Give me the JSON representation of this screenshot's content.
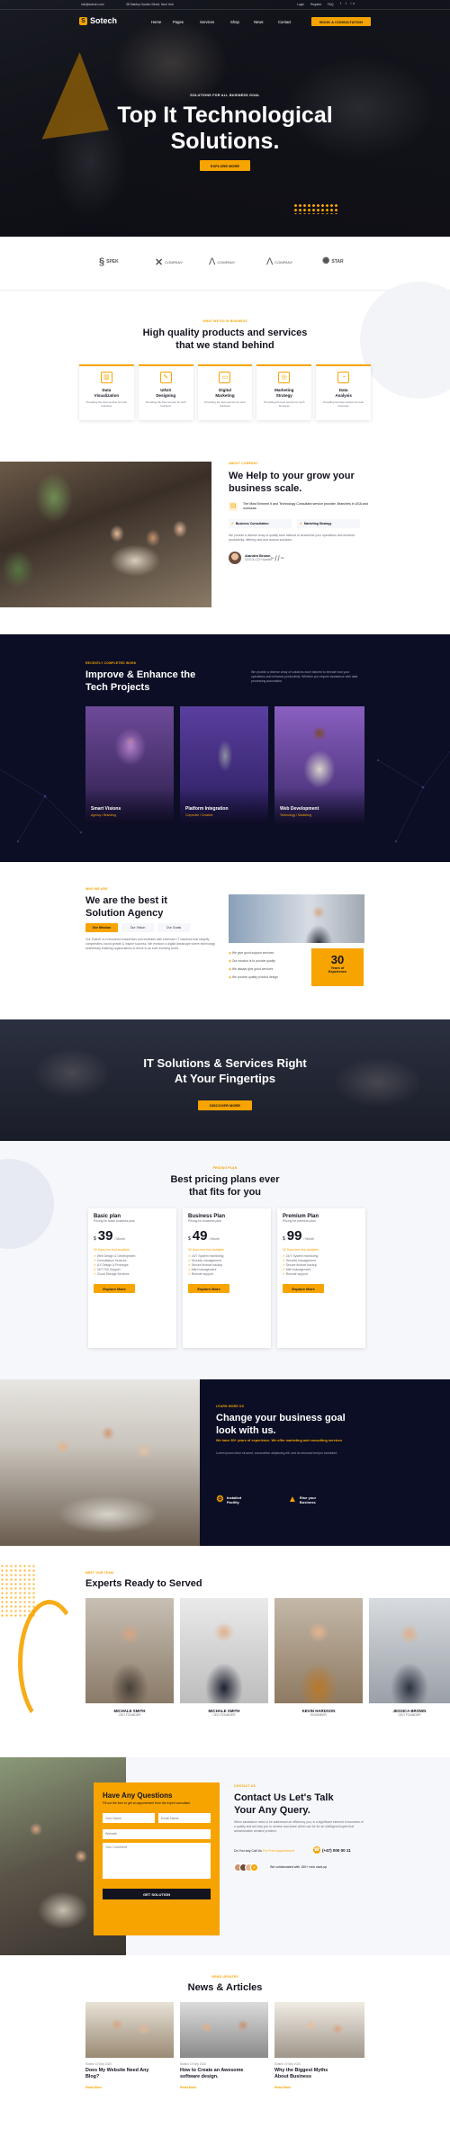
{
  "colors": {
    "accent": "#f7a400",
    "dark": "#13141f",
    "navy": "#0b0e24"
  },
  "topbar": {
    "email": "info@sotech.com",
    "address": "38 Stanley Garden Street, New York",
    "links": [
      "Login",
      "Register",
      "FAQ"
    ]
  },
  "header": {
    "logo_text": "Sotech",
    "nav": [
      "Home",
      "Pages",
      "Services",
      "Shop",
      "News",
      "Contact"
    ],
    "cta": "BOOK A CONSULTATION"
  },
  "hero": {
    "kicker": "SOLUTIONS FOR ALL BUSINESS GOAL",
    "title_line1": "Top It Technological",
    "title_line2": "Solutions.",
    "button": "EXPLORE MORE"
  },
  "brands": [
    "SPEK",
    "COMPANY",
    "COMPANY",
    "COMPANY",
    "STAR"
  ],
  "features": {
    "kicker": "WHAT WE DO IN BUSINESS",
    "title_line1": "High quality products and services",
    "title_line2": "that we stand behind",
    "items": [
      {
        "title_line1": "Data",
        "title_line2": "Visualization",
        "desc": "Providing the best service for tech business"
      },
      {
        "title_line1": "UI/UX",
        "title_line2": "Designing",
        "desc": "Providing the best service for tech business"
      },
      {
        "title_line1": "Digital",
        "title_line2": "Marketing",
        "desc": "Providing the best service for tech business"
      },
      {
        "title_line1": "Marketing",
        "title_line2": "Strategy",
        "desc": "Providing the best service for tech business"
      },
      {
        "title_line1": "Data",
        "title_line2": "Analysis",
        "desc": "Providing the best service for tech business"
      }
    ]
  },
  "about": {
    "kicker": "ABOUT COMPANY",
    "title_line1": "We Help to your grow your",
    "title_line2": "business scale.",
    "highlight": "The Most Eminent It and Technology Consultant service provider. Branches in USA and overseas.",
    "checks": [
      "Business Consultation",
      "Marketing Strategy"
    ],
    "para": "We provide a diverse array of quality work tailored to streamline your operations and enhance productivity, offering new and custom solutions.",
    "author_name": "Alandra Brown",
    "author_role": "CEO & CO Founder"
  },
  "projects": {
    "kicker": "RECENTLY COMPLETED WORK",
    "title_line1": "Improve & Enhance the",
    "title_line2": "Tech Projects",
    "desc": "We provide a diverse array of solutions each tailored to elevate how your operations and enhance productivity. Whether you require assistance with data processing automation.",
    "items": [
      {
        "title": "Smart Visions",
        "tags": "Agency / Branding"
      },
      {
        "title": "Platform Integration",
        "tags": "Corporate / Creative"
      },
      {
        "title": "Web Development",
        "tags": "Technology / Marketing"
      }
    ]
  },
  "agency": {
    "kicker": "WHO WE ARE",
    "title_line1": "We are the best it",
    "title_line2": "Solution Agency",
    "tabs": [
      "Our Mission",
      "Our Vision",
      "Our Goals"
    ],
    "para": "Our Sotech is a renowned businesses and institutes with extensive IT solutions that simplify complexities, boost growth & inspire success. We envision a digital landscape where technology seamlessly enabling organizations to thrive in an ever-evolving world.",
    "list": [
      "We give good support services",
      "Our mission is to provide quality",
      "We always give good services",
      "We provide quality product design"
    ],
    "years_num": "30",
    "years_l1": "Years of",
    "years_l2": "Experience"
  },
  "cta": {
    "title_line1": "IT Solutions & Services Right",
    "title_line2": "At Your Fingertips",
    "button": "DISCOVER MORE"
  },
  "pricing": {
    "kicker": "PRICING PLAN",
    "title_line1": "Best pricing plans ever",
    "title_line2": "that fits for you",
    "plans": [
      {
        "name": "Basic plan",
        "desc": "Pricing for basic business plan",
        "currency": "$",
        "price": "39",
        "period": "/ Month",
        "note": "30 Days free trial available",
        "features": [
          "Web Design & Development",
          "Consultation Services",
          "UX Design & Prototype",
          "24/7 Full Support",
          "Cloud Storage Services"
        ],
        "button": "Explore More"
      },
      {
        "name": "Business Plan",
        "desc": "Pricing for business plan",
        "currency": "$",
        "price": "49",
        "period": "/ Month",
        "note": "30 Days free trial available",
        "features": [
          "24/7 System monitoring",
          "Security management",
          "Secure finance backup",
          "Alert management",
          "Remote support"
        ],
        "button": "Explore More"
      },
      {
        "name": "Premium Plan",
        "desc": "Pricing for premium plan",
        "currency": "$",
        "price": "99",
        "period": "/ Month",
        "note": "30 Days free trial available",
        "features": [
          "24/7 System monitoring",
          "Security management",
          "Secure finance backup",
          "Alert management",
          "Remote support"
        ],
        "button": "Explore More"
      }
    ]
  },
  "growth": {
    "kicker": "LEARN MORE US",
    "title_line1": "Change your business goal",
    "title_line2": "look with us.",
    "highlight": "We have 30+ years of experience. We offer marketing and consulting services",
    "para": "Lorem ipsum dolor sit amet, consectetur adipiscing elit, sed do eiusmod tempor incididunt.",
    "features": [
      {
        "l1": "Installed",
        "l2": "Facility"
      },
      {
        "l1": "Rise your",
        "l2": "Business"
      }
    ]
  },
  "team": {
    "kicker": "MEET OUR TEAM",
    "title": "Experts Ready to Served",
    "members": [
      {
        "name": "MICHALE SMITH",
        "role": "CEO FOUNDER"
      },
      {
        "name": "MICHALE SMITH",
        "role": "CEO FOUNDER"
      },
      {
        "name": "KEVIN HARDSON",
        "role": "ENGINEER"
      },
      {
        "name": "JESSICA BROWN",
        "role": "CEO FOUNDER"
      }
    ]
  },
  "contact": {
    "form_title": "Have Any Questions",
    "form_desc": "Fill out the form to get an appointment from the expert consultant",
    "fields": [
      "Your Name",
      "Email Name",
      "Website",
      "Your Comment"
    ],
    "submit": "GET SOLUTION",
    "kicker": "CONTACT US",
    "title_line1": "Contact Us Let's Talk",
    "title_line2": "Your Any Query.",
    "para": "When assistance need to be addressed an efficiency you, is a significant element in business of a quality and we help you to receive and share which can be for an intelligent inspire that administrative creative problem.",
    "call_label": "Do You any Call Us",
    "call_sub": "For Free Appointment",
    "phone": "(+47) 000 00 11",
    "clients_text": "We collaborated with 150+ new start-up"
  },
  "news": {
    "kicker": "NEWS UPDATES",
    "title": "News & Articles",
    "posts": [
      {
        "title_line1": "Does My Website Need Any",
        "title_line2": "Blog?",
        "meta": "Sotech   19 Sep 2024"
      },
      {
        "title_line1": "How to Create an Awesome",
        "title_line2": "software design.",
        "meta": "Sotech   19 Sep 2024"
      },
      {
        "title_line1": "Why the Biggest Myths",
        "title_line2": "About Business",
        "meta": "Sotech   19 Sep 2024"
      }
    ],
    "read_more": "Read More"
  }
}
